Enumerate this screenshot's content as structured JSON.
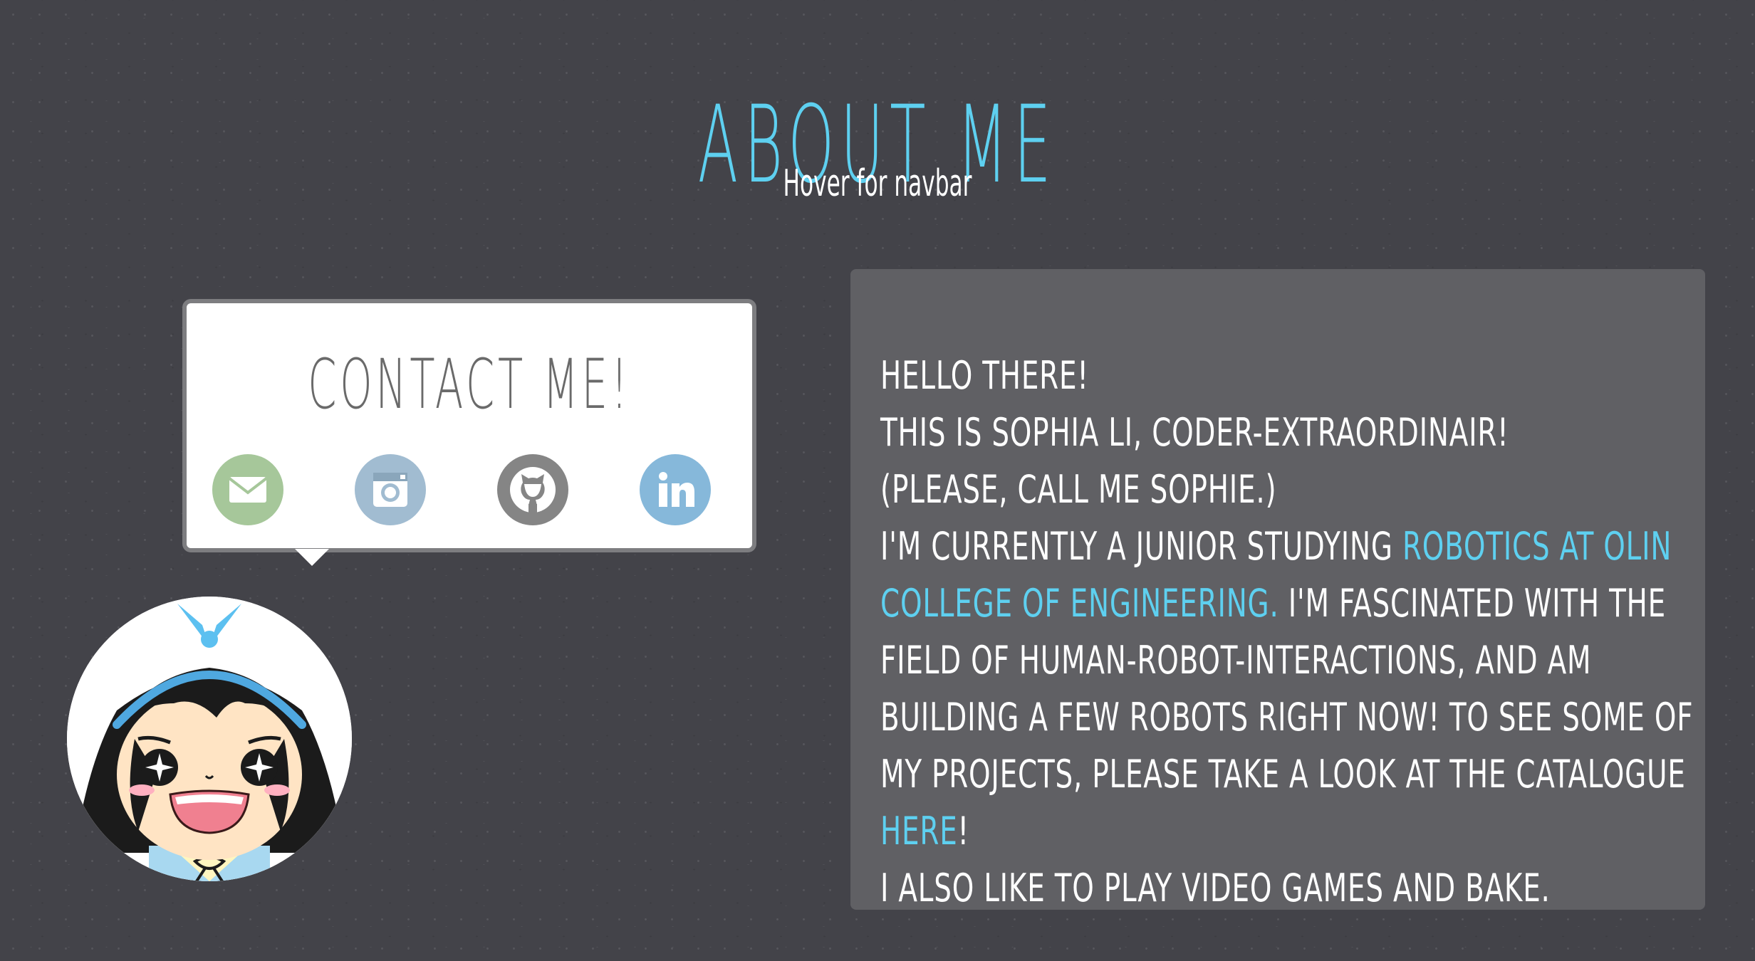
{
  "header": {
    "title": "About me",
    "nav_hint": "Hover for navbar"
  },
  "contact": {
    "title": "Contact me!",
    "links": [
      {
        "name": "email",
        "icon": "email-icon",
        "color": "#a6c79a"
      },
      {
        "name": "instagram",
        "icon": "instagram-icon",
        "color": "#a1bcd1"
      },
      {
        "name": "github",
        "icon": "github-icon",
        "color": "#858585"
      },
      {
        "name": "linkedin",
        "icon": "linkedin-icon",
        "color": "#86b8da"
      }
    ]
  },
  "about": {
    "greeting": "Hello there!",
    "intro": "This is Sophia Li, coder-extraordinair!",
    "nickname": "(Please, call me Sophie.)",
    "study_prefix": "I'm currently a junior studying ",
    "study_link": "Robotics at Olin College of Engineering.",
    "study_suffix": " I'm fascinated with the field of human-robot-interactions, and am building a few robots right now! To see some of my projects, please take a look at the catalogue ",
    "catalogue_link": "here",
    "catalogue_suffix": "!",
    "hobbies": "I also like to play video games and bake."
  },
  "colors": {
    "background": "#434349",
    "accent": "#5ed0f0",
    "panel": "#606064",
    "card_border": "#7d7d80"
  }
}
